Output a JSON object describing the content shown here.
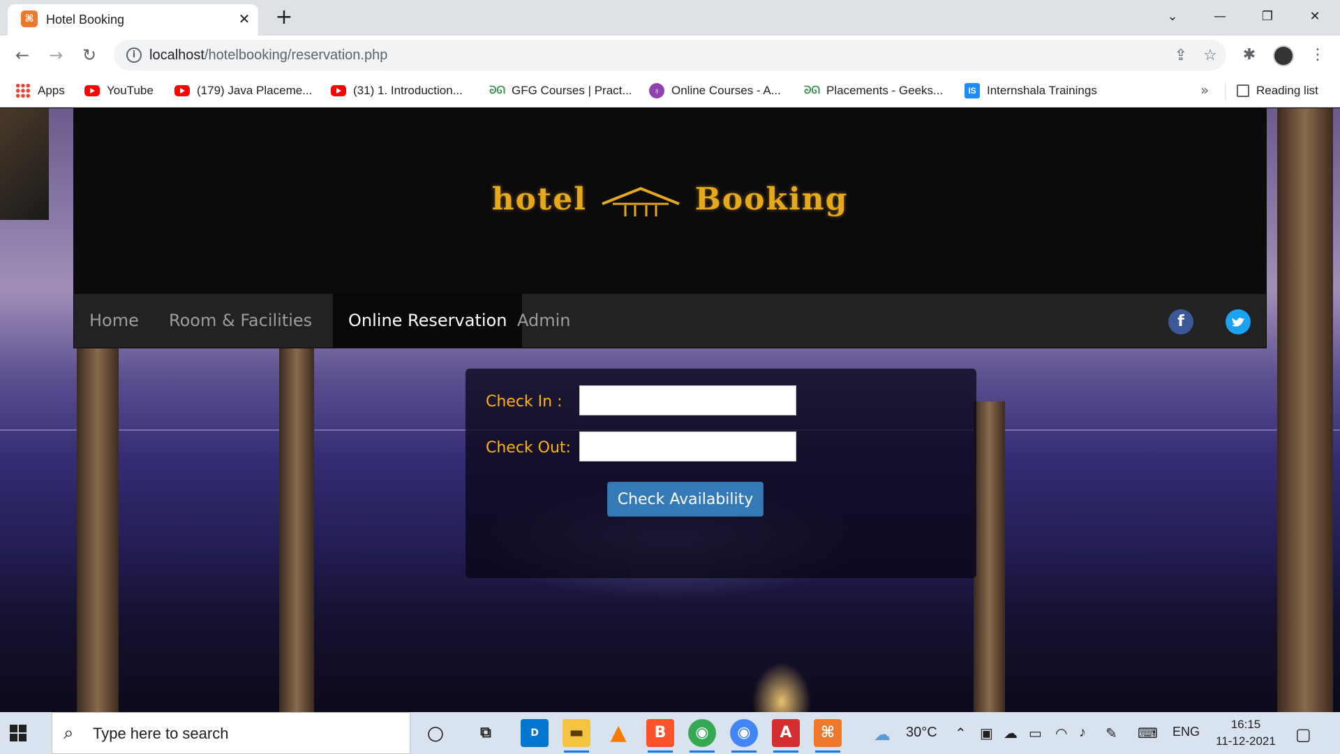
{
  "browser": {
    "tab_title": "Hotel Booking",
    "url_host": "localhost",
    "url_path": "/hotelbooking/reservation.php",
    "bookmarks": [
      {
        "label": "Apps",
        "icon": "apps-grid-icon"
      },
      {
        "label": "YouTube",
        "icon": "youtube-icon"
      },
      {
        "label": "(179) Java Placeme...",
        "icon": "youtube-icon"
      },
      {
        "label": "(31) 1. Introduction...",
        "icon": "youtube-icon"
      },
      {
        "label": "GFG Courses | Pract...",
        "icon": "gfg-icon"
      },
      {
        "label": "Online Courses - A...",
        "icon": "online-courses-icon"
      },
      {
        "label": "Placements - Geeks...",
        "icon": "gfg-icon"
      },
      {
        "label": "Internshala Trainings",
        "icon": "internshala-icon"
      }
    ],
    "reading_list": "Reading list"
  },
  "site": {
    "logo_left": "hotel",
    "logo_right": "Booking",
    "nav": [
      {
        "label": "Home",
        "active": false
      },
      {
        "label": "Room & Facilities",
        "active": false
      },
      {
        "label": "Online Reservation",
        "active": true
      },
      {
        "label": "Admin",
        "active": false
      }
    ],
    "social": {
      "facebook": "f",
      "twitter": "t"
    },
    "form": {
      "checkin_label": "Check In :",
      "checkout_label": "Check Out:",
      "checkin_value": "",
      "checkout_value": "",
      "submit_label": "Check Availability"
    }
  },
  "taskbar": {
    "search_placeholder": "Type here to search",
    "weather": "30°C",
    "language": "ENG",
    "time": "16:15",
    "date": "11-12-2021"
  },
  "colors": {
    "accent_gold": "#ffb400",
    "button_blue": "#337ab7",
    "nav_bg": "#222222"
  }
}
